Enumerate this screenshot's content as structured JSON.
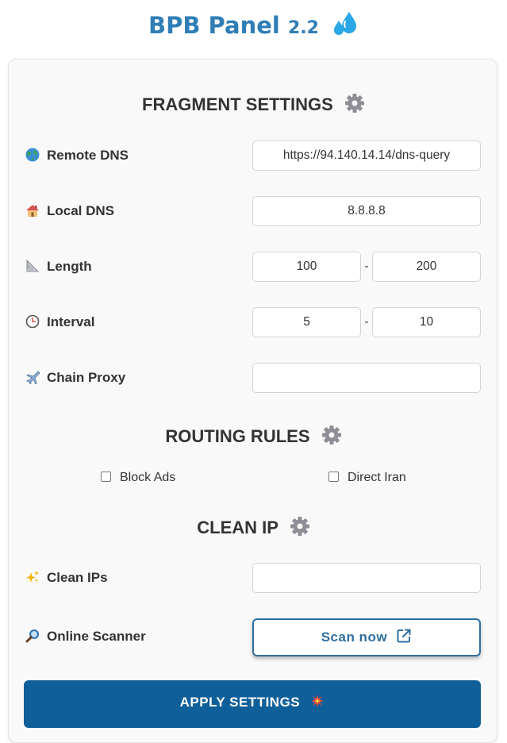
{
  "header": {
    "title": "BPB Panel",
    "version": "2.2",
    "logo_icon": "droplets-icon"
  },
  "colors": {
    "title": "#2f7eb5",
    "accent": "#2f6f9e",
    "apply_button_bg": "#0f5f9a"
  },
  "fragment": {
    "heading": "FRAGMENT SETTINGS",
    "remote_dns": {
      "label": "Remote DNS",
      "icon": "globe-icon",
      "value": "https://94.140.14.14/dns-query"
    },
    "local_dns": {
      "label": "Local DNS",
      "icon": "house-icon",
      "value": "8.8.8.8"
    },
    "length": {
      "label": "Length",
      "icon": "triangular-ruler-icon",
      "min": "100",
      "separator": "-",
      "max": "200"
    },
    "interval": {
      "label": "Interval",
      "icon": "clock-icon",
      "min": "5",
      "separator": "-",
      "max": "10"
    },
    "chain_proxy": {
      "label": "Chain Proxy",
      "icon": "airplane-icon",
      "value": ""
    }
  },
  "routing": {
    "heading": "ROUTING RULES",
    "block_ads": {
      "label": "Block Ads",
      "checked": false
    },
    "direct_iran": {
      "label": "Direct Iran",
      "checked": false
    }
  },
  "clean_ip": {
    "heading": "CLEAN IP",
    "clean_ips": {
      "label": "Clean IPs",
      "icon": "sparkles-icon",
      "value": ""
    },
    "online_scanner": {
      "label": "Online Scanner",
      "icon": "magnifier-icon",
      "button": "Scan now"
    }
  },
  "apply": {
    "label": "APPLY SETTINGS",
    "icon": "collision-icon"
  }
}
